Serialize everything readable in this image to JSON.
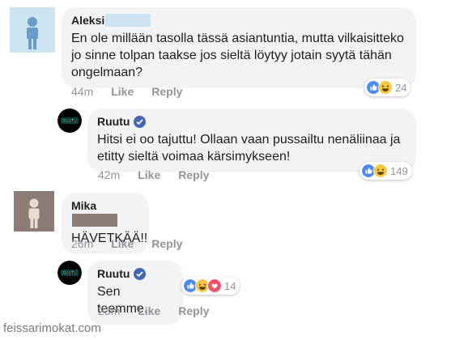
{
  "comments": [
    {
      "author": "Aleksi",
      "text": "En ole millään tasolla tässä asiantuntia, mutta vilkaisitteko jo sinne tolpan taakse jos sieltä löytyy jotain syytä tähän ongelmaan?",
      "time": "44m",
      "like_label": "Like",
      "reply_label": "Reply",
      "reaction_count": "24",
      "reactions": [
        "like-icon",
        "haha-icon"
      ]
    },
    {
      "author": "Ruutu",
      "verified": true,
      "text": "Hitsi ei oo tajuttu! Ollaan vaan pussailtu nenäliinaa ja etitty sieltä voimaa kärsimykseen!",
      "time": "42m",
      "like_label": "Like",
      "reply_label": "Reply",
      "reaction_count": "149",
      "reactions": [
        "like-icon",
        "haha-icon"
      ]
    },
    {
      "author": "Mika",
      "text": "HÄVETKÄÄ!!",
      "time": "26m",
      "like_label": "Like",
      "reply_label": "Reply"
    },
    {
      "author": "Ruutu",
      "verified": true,
      "text": "Sen teemme.",
      "time": "23m",
      "like_label": "Like",
      "reply_label": "Reply",
      "reaction_count": "14",
      "reactions": [
        "like-icon",
        "haha-icon",
        "love-icon"
      ]
    }
  ],
  "brand_logo_text": "RUUTU",
  "watermark": "feissarimokat.com",
  "colors": {
    "bubble": "#f2f3f5",
    "meta_text": "#90949c",
    "verified": "#4267b2",
    "like": "#4c8bf5",
    "haha": "#f7c842",
    "love": "#f25268",
    "ruutu_teal": "#26c6b3"
  }
}
